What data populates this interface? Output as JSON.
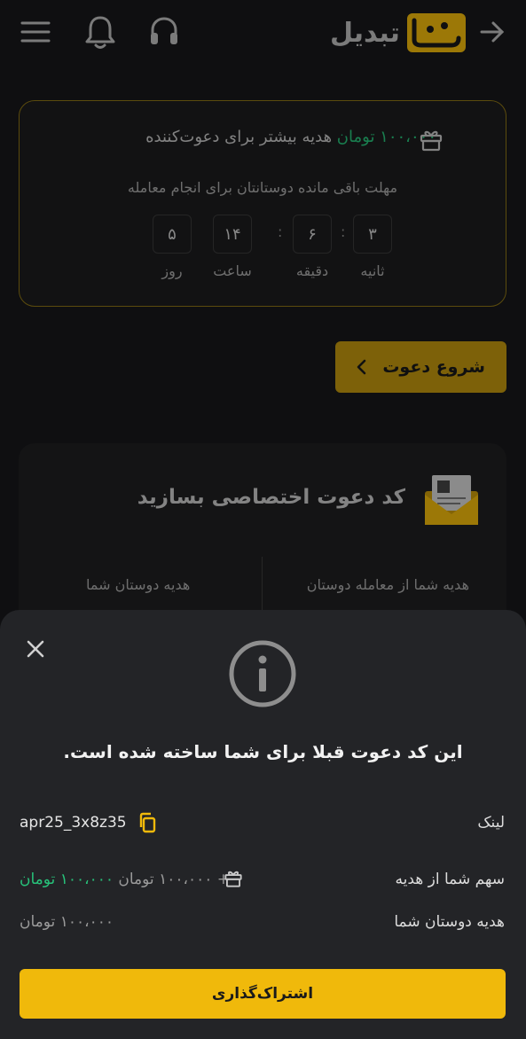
{
  "header": {
    "brand_name": "تبدیل",
    "icons": [
      "menu-icon",
      "bell-icon",
      "headset-icon",
      "arrow-right-icon"
    ]
  },
  "invite_card": {
    "gift_amount": "۱۰۰،۰۰۰ تومان",
    "gift_text": " هدیه بیشتر برای دعوت‌کننده",
    "deadline_text": "مهلت باقی مانده دوستانتان برای انجام معامله",
    "countdown": [
      {
        "value": "۵",
        "label": "روز"
      },
      {
        "value": "۱۴",
        "label": "ساعت"
      },
      {
        "value": "۶",
        "label": "دقیقه"
      },
      {
        "value": "۳",
        "label": "ثانیه"
      }
    ]
  },
  "start_button": {
    "label": "شروع دعوت"
  },
  "code_card": {
    "title": "کد دعوت اختصاصی بسازید",
    "col_right": "هدیه شما از معامله دوستان",
    "col_left": "هدیه دوستان شما"
  },
  "sheet": {
    "title": "این کد دعوت قبلا برای شما ساخته شده است.",
    "link_label": "لینک",
    "link_value": "apr25_3x8z35",
    "share_label": "سهم شما از هدیه",
    "share_value_green": "۱۰۰،۰۰۰ تومان",
    "share_value_rest": "+ ۱۰۰،۰۰۰ تومان",
    "friends_label": "هدیه دوستان شما",
    "friends_value": "۱۰۰،۰۰۰ تومان",
    "share_button": "اشتراک‌گذاری"
  },
  "colors": {
    "accent": "#f0b90b",
    "green": "#27c27a",
    "background": "#17181b",
    "sheet": "#232427"
  }
}
